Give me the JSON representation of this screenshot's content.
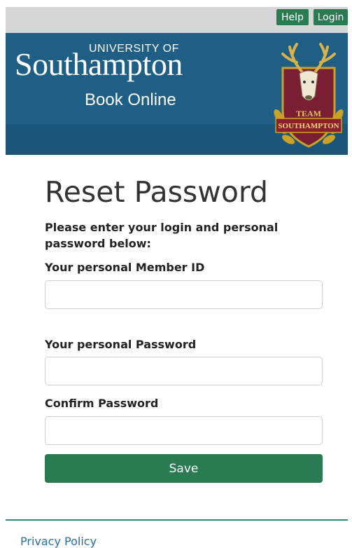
{
  "header": {
    "help_label": "Help",
    "login_label": "Login"
  },
  "banner": {
    "university": "UNIVERSITY OF",
    "name": "Southampton",
    "subtitle": "Book Online",
    "crest_team": "TEAM",
    "crest_name": "SOUTHAMPTON"
  },
  "form": {
    "title": "Reset Password",
    "intro": "Please enter your login and personal password below:",
    "member_id_label": "Your personal Member ID",
    "member_id_value": "",
    "password_label": "Your personal Password",
    "password_value": "",
    "confirm_label": "Confirm Password",
    "confirm_value": "",
    "save_label": "Save"
  },
  "footer": {
    "privacy_label": "Privacy Policy"
  },
  "colors": {
    "banner_blue": "#1f5f86",
    "accent_green": "#2a7a52",
    "link_blue": "#2a6fa0"
  }
}
